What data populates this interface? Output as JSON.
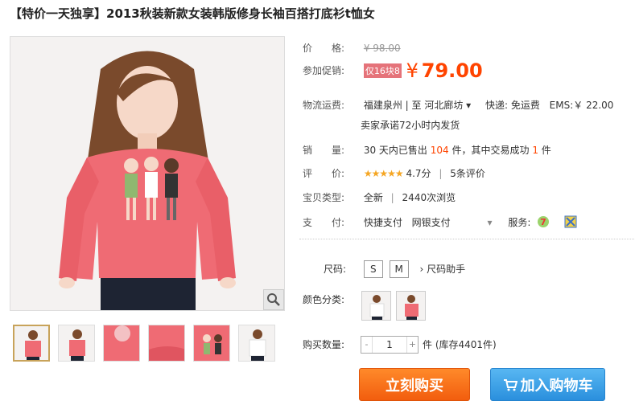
{
  "title": "【特价一天独享】2013秋装新款女装韩版修身长袖百搭打底衫t恤女",
  "price": {
    "label": "价　　格:",
    "original": "¥ 98.00"
  },
  "promo": {
    "label": "参加促销:",
    "tag": "仅16块8",
    "currency": "¥",
    "value": "79.00"
  },
  "shipping": {
    "label": "物流运费:",
    "route": "福建泉州 | 至  河北廊坊 ▾",
    "express": "快递: 免运费",
    "ems": "EMS:￥ 22.00",
    "promise": "卖家承诺72小时内发货"
  },
  "sales": {
    "label": "销　　量:",
    "prefix": "30 天内已售出",
    "sold": "104",
    "mid": "件，其中交易成功",
    "success": "1",
    "suffix": "件"
  },
  "rating": {
    "label": "评　　价:",
    "stars": "★★★★★",
    "score": "4.7分",
    "reviews": "5条评价"
  },
  "type": {
    "label": "宝贝类型:",
    "condition": "全新",
    "views": "2440次浏览"
  },
  "payment": {
    "label": "支　　付:",
    "methods": [
      "快捷支付",
      "网银支付"
    ],
    "service_label": "服务:"
  },
  "size": {
    "label": "尺码:",
    "options": [
      "S",
      "M"
    ],
    "helper": "尺码助手"
  },
  "color": {
    "label": "颜色分类:"
  },
  "quantity": {
    "label": "购买数量:",
    "value": "1",
    "minus": "-",
    "plus": "+",
    "stock": "件 (库存4401件)"
  },
  "buttons": {
    "buy": "立刻购买",
    "cart": "加入购物车"
  },
  "colors": {
    "accent": "#ff4400",
    "buy": "#f25d0e",
    "cart": "#2a8fdd",
    "shirt": "#ef6b74"
  }
}
